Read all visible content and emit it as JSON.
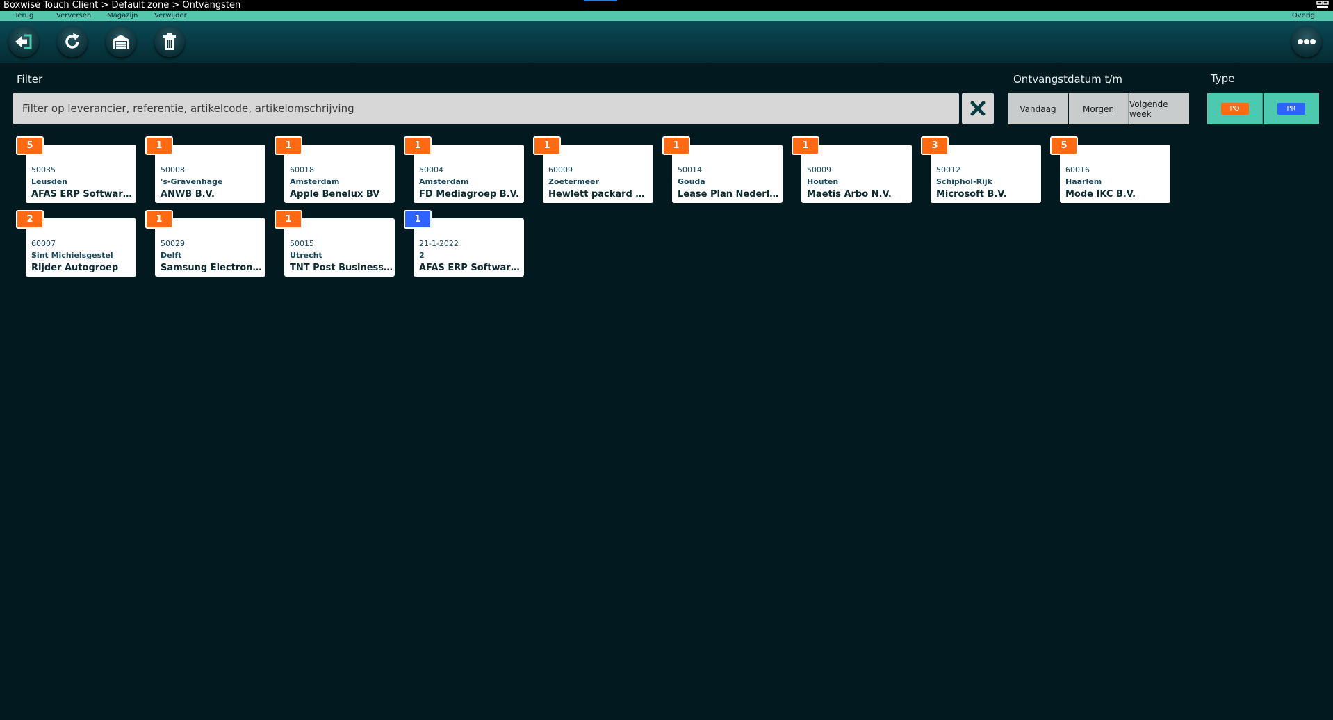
{
  "window": {
    "title": "Boxwise Touch Client > Default zone > Ontvangsten"
  },
  "menu": {
    "back": "Terug",
    "refresh": "Verversen",
    "warehouse": "Magazijn",
    "delete": "Verwijder",
    "other": "Overig"
  },
  "filter": {
    "label": "Filter",
    "placeholder": "Filter op leverancier, referentie, artikelcode, artikelomschrijving",
    "value": ""
  },
  "date": {
    "label": "Ontvangstdatum t/m",
    "options": [
      "Vandaag",
      "Morgen",
      "Volgende week"
    ]
  },
  "type": {
    "label": "Type",
    "options": [
      {
        "label": "PO",
        "color": "#ff6a13"
      },
      {
        "label": "PR",
        "color": "#2f63ff"
      }
    ]
  },
  "colors": {
    "po": "#ff6a13",
    "pr": "#2f63ff",
    "accent": "#54c7ad"
  },
  "cards": [
    {
      "count": "5",
      "code": "50035",
      "city": "Leusden",
      "name": "AFAS ERP Software ...",
      "type": "PO"
    },
    {
      "count": "1",
      "code": "50008",
      "city": "'s-Gravenhage",
      "name": "ANWB B.V.",
      "type": "PO"
    },
    {
      "count": "1",
      "code": "60018",
      "city": "Amsterdam",
      "name": "Apple Benelux BV",
      "type": "PO"
    },
    {
      "count": "1",
      "code": "50004",
      "city": "Amsterdam",
      "name": "FD Mediagroep B.V.",
      "type": "PO"
    },
    {
      "count": "1",
      "code": "60009",
      "city": "Zoetermeer",
      "name": "Hewlett packard B.V.",
      "type": "PO"
    },
    {
      "count": "1",
      "code": "50014",
      "city": "Gouda",
      "name": "Lease Plan Nederla...",
      "type": "PO"
    },
    {
      "count": "1",
      "code": "50009",
      "city": "Houten",
      "name": "Maetis Arbo N.V.",
      "type": "PO"
    },
    {
      "count": "3",
      "code": "50012",
      "city": "Schiphol-Rijk",
      "name": "Microsoft B.V.",
      "type": "PO"
    },
    {
      "count": "5",
      "code": "60016",
      "city": "Haarlem",
      "name": "Mode IKC B.V.",
      "type": "PO"
    },
    {
      "count": "2",
      "code": "60007",
      "city": "Sint Michielsgestel",
      "name": "Rijder Autogroep",
      "type": "PO"
    },
    {
      "count": "1",
      "code": "50029",
      "city": "Delft",
      "name": "Samsung Electronic...",
      "type": "PO"
    },
    {
      "count": "1",
      "code": "50015",
      "city": "Utrecht",
      "name": "TNT Post Business S...",
      "type": "PO"
    },
    {
      "count": "1",
      "code": "21-1-2022",
      "city": "2",
      "name": "AFAS ERP Software ...",
      "type": "PR"
    }
  ]
}
